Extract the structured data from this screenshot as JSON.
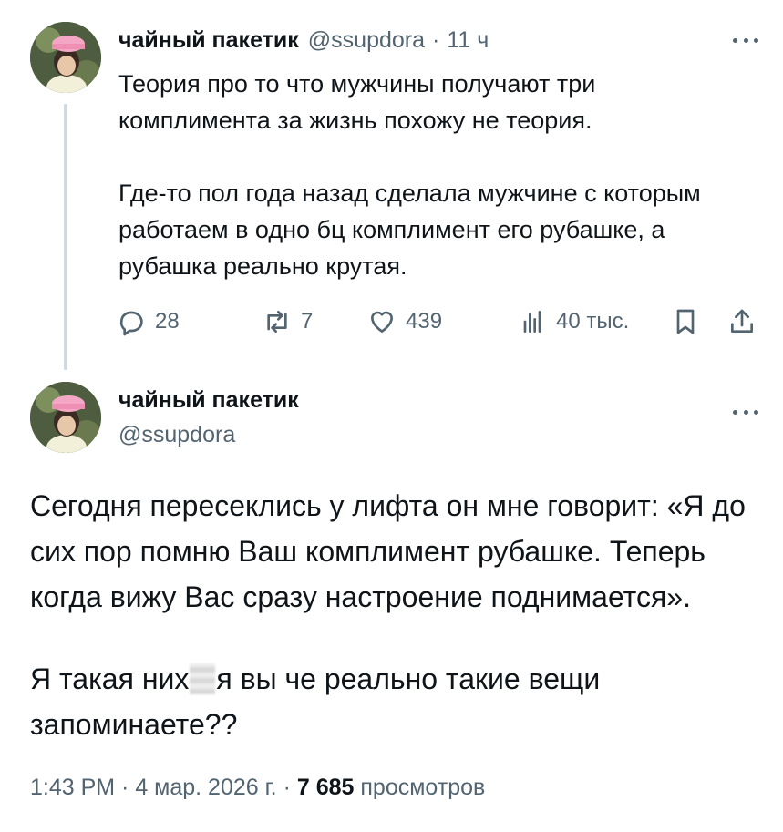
{
  "tweet1": {
    "avatar": "avatar-photo",
    "name": "чайный пакетик",
    "handle": "@ssupdora",
    "separator": "·",
    "time": "11 ч",
    "text_p1": "Теория про то что мужчины получают три\nкомплимента за жизнь похожу не теория.",
    "text_p2": "Где-то пол года назад сделала мужчине с которым\nработаем в одно бц комплимент его рубашке, а\nрубашка реально крутая.",
    "actions": {
      "reply_icon": "reply-icon",
      "replies": "28",
      "repost_icon": "repost-icon",
      "reposts": "7",
      "like_icon": "heart-icon",
      "likes": "439",
      "views_icon": "analytics-icon",
      "views": "40 тыс.",
      "bookmark_icon": "bookmark-icon",
      "share_icon": "share-icon"
    }
  },
  "tweet2": {
    "avatar": "avatar-photo",
    "name": "чайный пакетик",
    "handle": "@ssupdora",
    "text_p1": "Сегодня пересеклись у лифта он мне говорит: «Я до\nсих пор помню Ваш комплимент рубашке. Теперь\nкогда вижу Вас сразу настроение поднимается».",
    "text_p2_before": "Я такая них",
    "text_p2_after": "я вы че реально такие вещи\nзапоминаете??",
    "timestamp": "1:43 PM · 4 мар. 2026 г. · ",
    "views_count": "7 685",
    "views_label": "просмотров"
  },
  "colors": {
    "text": "#0f1419",
    "secondary": "#536471",
    "thread_line": "#cfd9de"
  }
}
